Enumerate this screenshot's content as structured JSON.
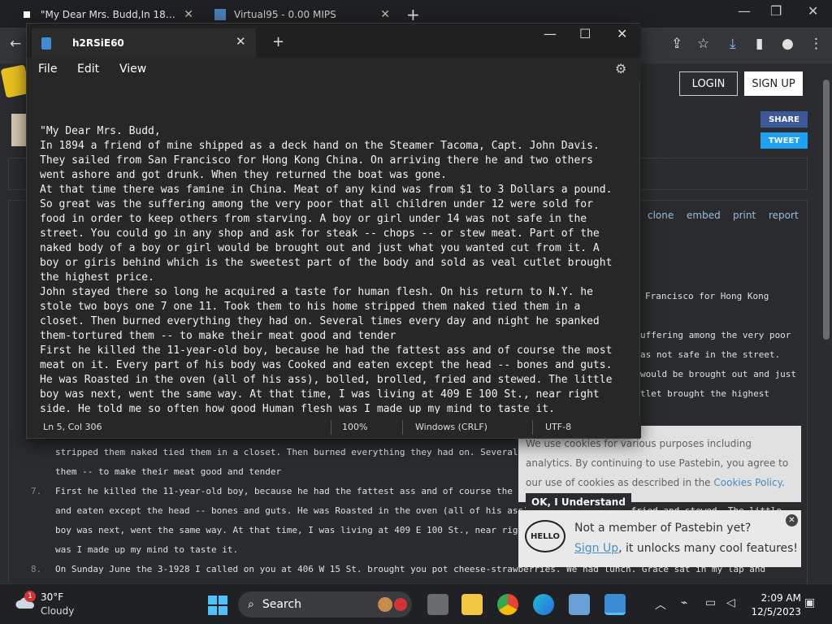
{
  "browser": {
    "tabs": [
      {
        "title": "\"My Dear Mrs. Budd,In 1894 a fr"
      },
      {
        "title": "Virtual95 - 0.00 MIPS"
      }
    ]
  },
  "pastebin": {
    "login_label": "LOGIN",
    "signup_label": "SIGN UP",
    "share_label": "SHARE",
    "tweet_label": "TWEET",
    "actions": [
      "clone",
      "embed",
      "print",
      "report"
    ],
    "right_fragments": [
      "Francisco for Hong Kong",
      "uffering among the very poor",
      "as not safe in the street.",
      "would be brought out and just",
      "tlet brought the highest"
    ],
    "lines": [
      {
        "num": "",
        "text": "stripped them naked tied them in a closet. Then burned everything they had on. Several"
      },
      {
        "num": "",
        "text": "them -- to make their meat good and tender"
      },
      {
        "num": "7.",
        "text": "First he killed the 11-year-old boy, because he had the fattest ass and of course the m"
      },
      {
        "num": "",
        "text": "and eaten except the head -- bones and guts. He was Roasted in the oven (all of his ass), bolled, brolled, fried and stewed. The little"
      },
      {
        "num": "",
        "text": "boy was next, went the same way. At that time, I was living at 409 E 100 St., near rig"
      },
      {
        "num": "",
        "text": "was I made up my mind to taste it."
      },
      {
        "num": "8.",
        "text": "On Sunday June the 3-1928 I called on you at 406 W 15 St. brought you pot cheese-strawberries. We had lunch. Grace sat in my lap and"
      }
    ],
    "cookie": {
      "text_before": "We use cookies for various purposes including analytics. By continuing to use Pastebin, you agree to our use of cookies as described in the ",
      "link": "Cookies Policy",
      "text_after": ".",
      "ok_label": "OK, I Understand"
    },
    "member": {
      "hello": "HELLO",
      "line1": "Not a member of Pastebin yet?",
      "signup_link": "Sign Up",
      "line2_rest": ", it unlocks many cool features!"
    }
  },
  "notepad": {
    "tab_title": "h2RSiE60",
    "menu": [
      "File",
      "Edit",
      "View"
    ],
    "text": "\"My Dear Mrs. Budd,\nIn 1894 a friend of mine shipped as a deck hand on the Steamer Tacoma, Capt. John Davis.\nThey sailed from San Francisco for Hong Kong China. On arriving there he and two others\nwent ashore and got drunk. When they returned the boat was gone.\nAt that time there was famine in China. Meat of any kind was from $1 to 3 Dollars a pound.\nSo great was the suffering among the very poor that all children under 12 were sold for\nfood in order to keep others from starving. A boy or girl under 14 was not safe in the\nstreet. You could go in any shop and ask for steak -- chops -- or stew meat. Part of the\nnaked body of a boy or girl would be brought out and just what you wanted cut from it. A\nboy or giris behind which is the sweetest part of the body and sold as veal cutlet brought\nthe highest price.\nJohn stayed there so long he acquired a taste for human flesh. On his return to N.Y. he\nstole two boys one 7 one 11. Took them to his home stripped them naked tied them in a\ncloset. Then burned everything they had on. Several times every day and night he spanked\nthem-tortured them -- to make their meat good and tender\nFirst he killed the 11-year-old boy, because he had the fattest ass and of course the most\nmeat on it. Every part of his body was Cooked and eaten except the head -- bones and guts.\nHe was Roasted in the oven (all of his ass), bolled, brolled, fried and stewed. The little\nboy was next, went the same way. At that time, I was living at 409 E 100 St., near right\nside. He told me so often how good Human flesh was I made up my mind to taste it.",
    "status": {
      "position": "Ln 5, Col 306",
      "zoom": "100%",
      "line_ending": "Windows (CRLF)",
      "encoding": "UTF-8"
    }
  },
  "taskbar": {
    "weather_badge": "1",
    "temp": "30°F",
    "condition": "Cloudy",
    "search_label": "Search",
    "time": "2:09 AM",
    "date": "12/5/2023"
  },
  "colors": {
    "accent": "#4cc2ff",
    "notepad_bg": "#272727",
    "link": "#4a90c8"
  }
}
